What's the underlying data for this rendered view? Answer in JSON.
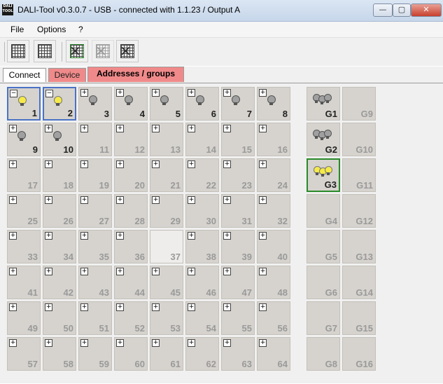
{
  "window": {
    "title": "DALI-Tool v0.3.0.7 - USB - connected with 1.1.23 / Output A",
    "icon_text": "DALI TOOL",
    "controls": [
      "—",
      "▢",
      "✕"
    ]
  },
  "menu": [
    "File",
    "Options",
    "?"
  ],
  "toolbar": [
    {
      "icon": "grid-icon"
    },
    {
      "icon": "grid-resize-icon"
    },
    {
      "icon": "grid-delete-icon"
    },
    {
      "icon": "grid-delete-disabled-icon"
    },
    {
      "icon": "grid-delete-all-icon"
    }
  ],
  "tabs": [
    {
      "label": "Connect",
      "active": false
    },
    {
      "label": "Device",
      "active": false
    },
    {
      "label": "Addresses / groups",
      "active": true
    }
  ],
  "addresses": [
    {
      "label": "1",
      "state": "on",
      "toggle": "−",
      "selected": true
    },
    {
      "label": "2",
      "state": "on",
      "toggle": "−",
      "selected": true
    },
    {
      "label": "3",
      "state": "off",
      "toggle": "+"
    },
    {
      "label": "4",
      "state": "off",
      "toggle": "+"
    },
    {
      "label": "5",
      "state": "off",
      "toggle": "+"
    },
    {
      "label": "6",
      "state": "off",
      "toggle": "+"
    },
    {
      "label": "7",
      "state": "off",
      "toggle": "+"
    },
    {
      "label": "8",
      "state": "off",
      "toggle": "+"
    },
    {
      "label": "9",
      "state": "off",
      "toggle": "+"
    },
    {
      "label": "10",
      "state": "off",
      "toggle": "+"
    },
    {
      "label": "11",
      "toggle": "+"
    },
    {
      "label": "12",
      "toggle": "+"
    },
    {
      "label": "13",
      "toggle": "+"
    },
    {
      "label": "14",
      "toggle": "+"
    },
    {
      "label": "15",
      "toggle": "+"
    },
    {
      "label": "16",
      "toggle": "+"
    },
    {
      "label": "17",
      "toggle": "+"
    },
    {
      "label": "18",
      "toggle": "+"
    },
    {
      "label": "19",
      "toggle": "+"
    },
    {
      "label": "20",
      "toggle": "+"
    },
    {
      "label": "21",
      "toggle": "+"
    },
    {
      "label": "22",
      "toggle": "+"
    },
    {
      "label": "23",
      "toggle": "+"
    },
    {
      "label": "24",
      "toggle": "+"
    },
    {
      "label": "25",
      "toggle": "+"
    },
    {
      "label": "26",
      "toggle": "+"
    },
    {
      "label": "27",
      "toggle": "+"
    },
    {
      "label": "28",
      "toggle": "+"
    },
    {
      "label": "29",
      "toggle": "+"
    },
    {
      "label": "30",
      "toggle": "+"
    },
    {
      "label": "31",
      "toggle": "+"
    },
    {
      "label": "32",
      "toggle": "+"
    },
    {
      "label": "33",
      "toggle": "+"
    },
    {
      "label": "34",
      "toggle": "+"
    },
    {
      "label": "35",
      "toggle": "+"
    },
    {
      "label": "36",
      "toggle": "+"
    },
    {
      "label": "37",
      "toggle": "",
      "light": true
    },
    {
      "label": "38",
      "toggle": "+"
    },
    {
      "label": "39",
      "toggle": "+"
    },
    {
      "label": "40",
      "toggle": "+"
    },
    {
      "label": "41",
      "toggle": "+"
    },
    {
      "label": "42",
      "toggle": "+"
    },
    {
      "label": "43",
      "toggle": "+"
    },
    {
      "label": "44",
      "toggle": "+"
    },
    {
      "label": "45",
      "toggle": "+"
    },
    {
      "label": "46",
      "toggle": "+"
    },
    {
      "label": "47",
      "toggle": "+"
    },
    {
      "label": "48",
      "toggle": "+"
    },
    {
      "label": "49",
      "toggle": "+"
    },
    {
      "label": "50",
      "toggle": "+"
    },
    {
      "label": "51",
      "toggle": "+"
    },
    {
      "label": "52",
      "toggle": "+"
    },
    {
      "label": "53",
      "toggle": "+"
    },
    {
      "label": "54",
      "toggle": "+"
    },
    {
      "label": "55",
      "toggle": "+"
    },
    {
      "label": "56",
      "toggle": "+"
    },
    {
      "label": "57",
      "toggle": "+"
    },
    {
      "label": "58",
      "toggle": "+"
    },
    {
      "label": "59",
      "toggle": "+"
    },
    {
      "label": "60",
      "toggle": "+"
    },
    {
      "label": "61",
      "toggle": "+"
    },
    {
      "label": "62",
      "toggle": "+"
    },
    {
      "label": "63",
      "toggle": "+"
    },
    {
      "label": "64",
      "toggle": "+"
    }
  ],
  "groups": [
    {
      "label": "G1",
      "state": "off"
    },
    {
      "label": "G9"
    },
    {
      "label": "G2",
      "state": "off"
    },
    {
      "label": "G10"
    },
    {
      "label": "G3",
      "state": "on",
      "selected": true
    },
    {
      "label": "G11"
    },
    {
      "label": "G4"
    },
    {
      "label": "G12"
    },
    {
      "label": "G5"
    },
    {
      "label": "G13"
    },
    {
      "label": "G6"
    },
    {
      "label": "G14"
    },
    {
      "label": "G7"
    },
    {
      "label": "G15"
    },
    {
      "label": "G8"
    },
    {
      "label": "G16"
    }
  ]
}
